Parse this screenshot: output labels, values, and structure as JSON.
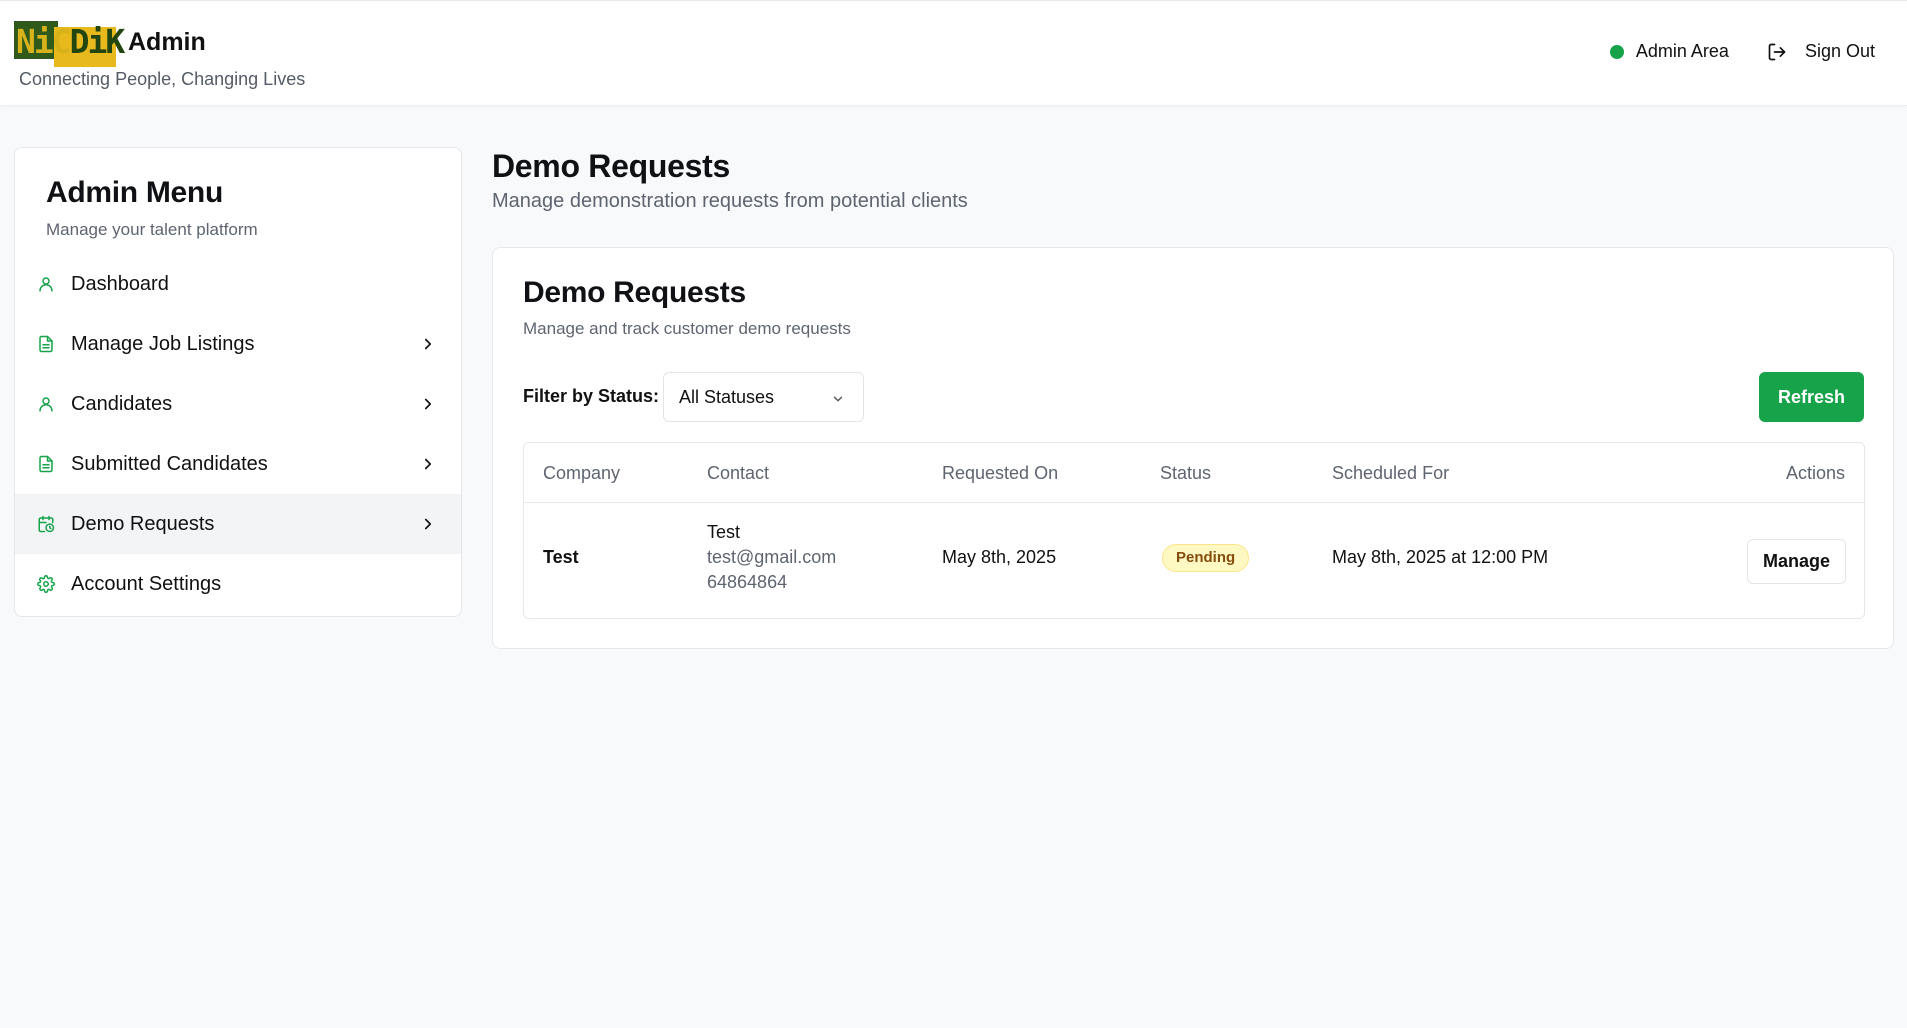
{
  "colors": {
    "accent": "#16a34a",
    "badge_bg": "#fef9c3",
    "badge_text": "#854d0e",
    "logo_green": "#2f5a1a",
    "logo_yellow": "#e7b91c"
  },
  "header": {
    "logo_text_a": "NiC",
    "logo_text_b": "DiK",
    "title": "Admin",
    "tagline": "Connecting People, Changing Lives",
    "admin_area": "Admin Area",
    "sign_out": "Sign Out"
  },
  "sidebar": {
    "title": "Admin Menu",
    "subtitle": "Manage your talent platform",
    "items": [
      {
        "label": "Dashboard",
        "icon": "user-icon",
        "chevron": false
      },
      {
        "label": "Manage Job Listings",
        "icon": "document-icon",
        "chevron": true
      },
      {
        "label": "Candidates",
        "icon": "user-icon",
        "chevron": true
      },
      {
        "label": "Submitted Candidates",
        "icon": "document-icon",
        "chevron": true
      },
      {
        "label": "Demo Requests",
        "icon": "calendar-clock-icon",
        "chevron": true,
        "active": true
      },
      {
        "label": "Account Settings",
        "icon": "gear-icon",
        "chevron": false
      }
    ]
  },
  "page": {
    "title": "Demo Requests",
    "subtitle": "Manage demonstration requests from potential clients"
  },
  "card": {
    "title": "Demo Requests",
    "subtitle": "Manage and track customer demo requests",
    "filter_label": "Filter by Status:",
    "filter_value": "All Statuses",
    "refresh_label": "Refresh",
    "table": {
      "headers": [
        "Company",
        "Contact",
        "Requested On",
        "Status",
        "Scheduled For",
        "Actions"
      ],
      "rows": [
        {
          "company": "Test",
          "contact_name": "Test",
          "contact_email": "test@gmail.com",
          "contact_phone": "64864864",
          "requested_on": "May 8th, 2025",
          "status": "Pending",
          "scheduled_for": "May 8th, 2025 at 12:00 PM",
          "action": "Manage"
        }
      ]
    }
  }
}
